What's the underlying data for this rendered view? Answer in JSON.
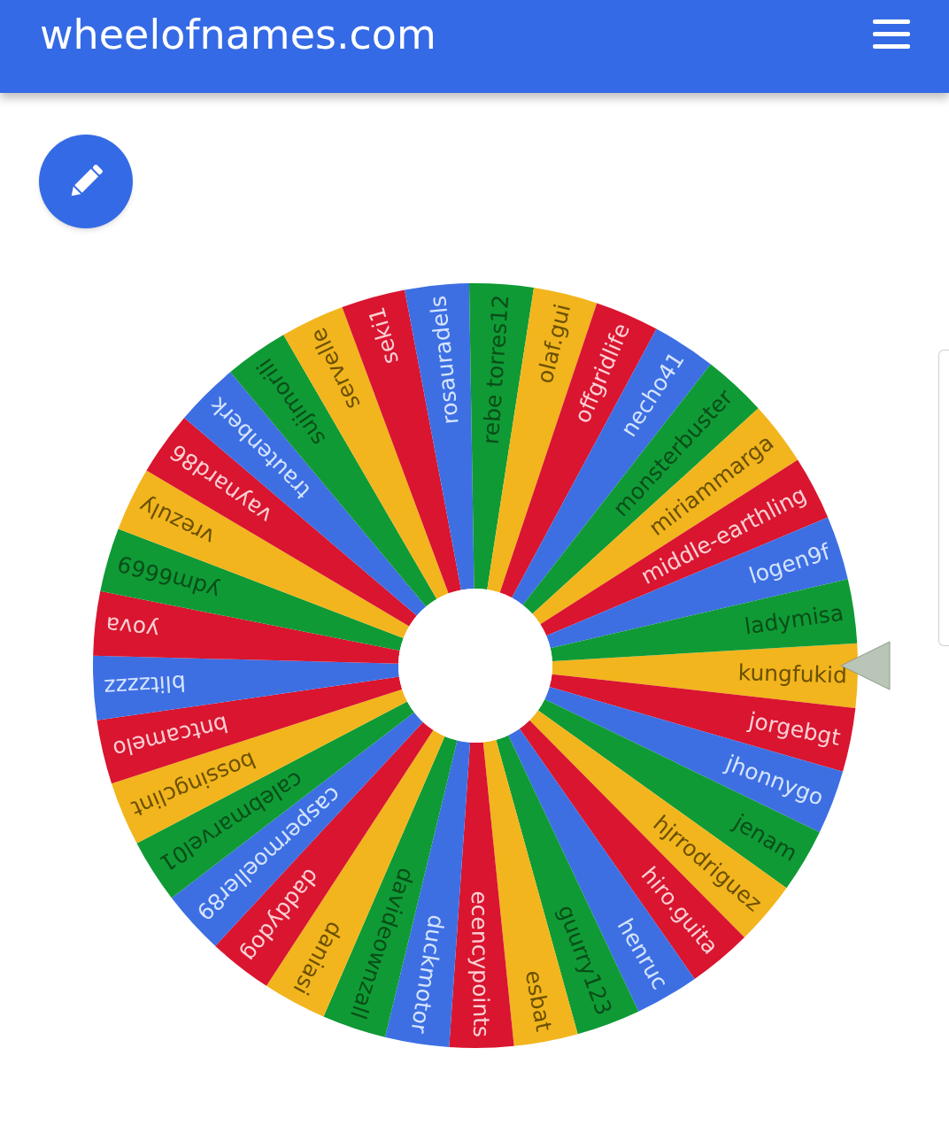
{
  "header": {
    "title": "wheelofnames.com"
  },
  "wheel": {
    "segments": [
      {
        "label": "kungfukid",
        "color": "#f2b51d"
      },
      {
        "label": "jorgebgt",
        "color": "#d9152f"
      },
      {
        "label": "jhonnygo",
        "color": "#3d6fe3"
      },
      {
        "label": "jenam",
        "color": "#0f9a35"
      },
      {
        "label": "hjrrodriguez",
        "color": "#f2b51d"
      },
      {
        "label": "hiro.guita",
        "color": "#d9152f"
      },
      {
        "label": "henruc",
        "color": "#3d6fe3"
      },
      {
        "label": "guurry123",
        "color": "#0f9a35"
      },
      {
        "label": "esbat",
        "color": "#f2b51d"
      },
      {
        "label": "ecencypoints",
        "color": "#d9152f"
      },
      {
        "label": "duckmotor",
        "color": "#3d6fe3"
      },
      {
        "label": "davideownzall",
        "color": "#0f9a35"
      },
      {
        "label": "daniasi",
        "color": "#f2b51d"
      },
      {
        "label": "daddydog",
        "color": "#d9152f"
      },
      {
        "label": "caspermoeller89",
        "color": "#3d6fe3"
      },
      {
        "label": "calebmarvel01",
        "color": "#0f9a35"
      },
      {
        "label": "bossingclint",
        "color": "#f2b51d"
      },
      {
        "label": "bntcamelo",
        "color": "#d9152f"
      },
      {
        "label": "blitzzzz",
        "color": "#3d6fe3"
      },
      {
        "label": "yova",
        "color": "#d9152f"
      },
      {
        "label": "ydm6669",
        "color": "#0f9a35"
      },
      {
        "label": "vrezuly",
        "color": "#f2b51d"
      },
      {
        "label": "vaynard86",
        "color": "#d9152f"
      },
      {
        "label": "trautenberk",
        "color": "#3d6fe3"
      },
      {
        "label": "sujimorili",
        "color": "#0f9a35"
      },
      {
        "label": "servelle",
        "color": "#f2b51d"
      },
      {
        "label": "seki1",
        "color": "#d9152f"
      },
      {
        "label": "rosauradels",
        "color": "#3d6fe3"
      },
      {
        "label": "rebe torres12",
        "color": "#0f9a35"
      },
      {
        "label": "olaf.gui",
        "color": "#f2b51d"
      },
      {
        "label": "offgridlife",
        "color": "#d9152f"
      },
      {
        "label": "necho41",
        "color": "#3d6fe3"
      },
      {
        "label": "monsterbuster",
        "color": "#0f9a35"
      },
      {
        "label": "miriammarga",
        "color": "#f2b51d"
      },
      {
        "label": "middle-earthling",
        "color": "#d9152f"
      },
      {
        "label": "logen9f",
        "color": "#3d6fe3"
      },
      {
        "label": "ladymisa",
        "color": "#0f9a35"
      }
    ]
  }
}
